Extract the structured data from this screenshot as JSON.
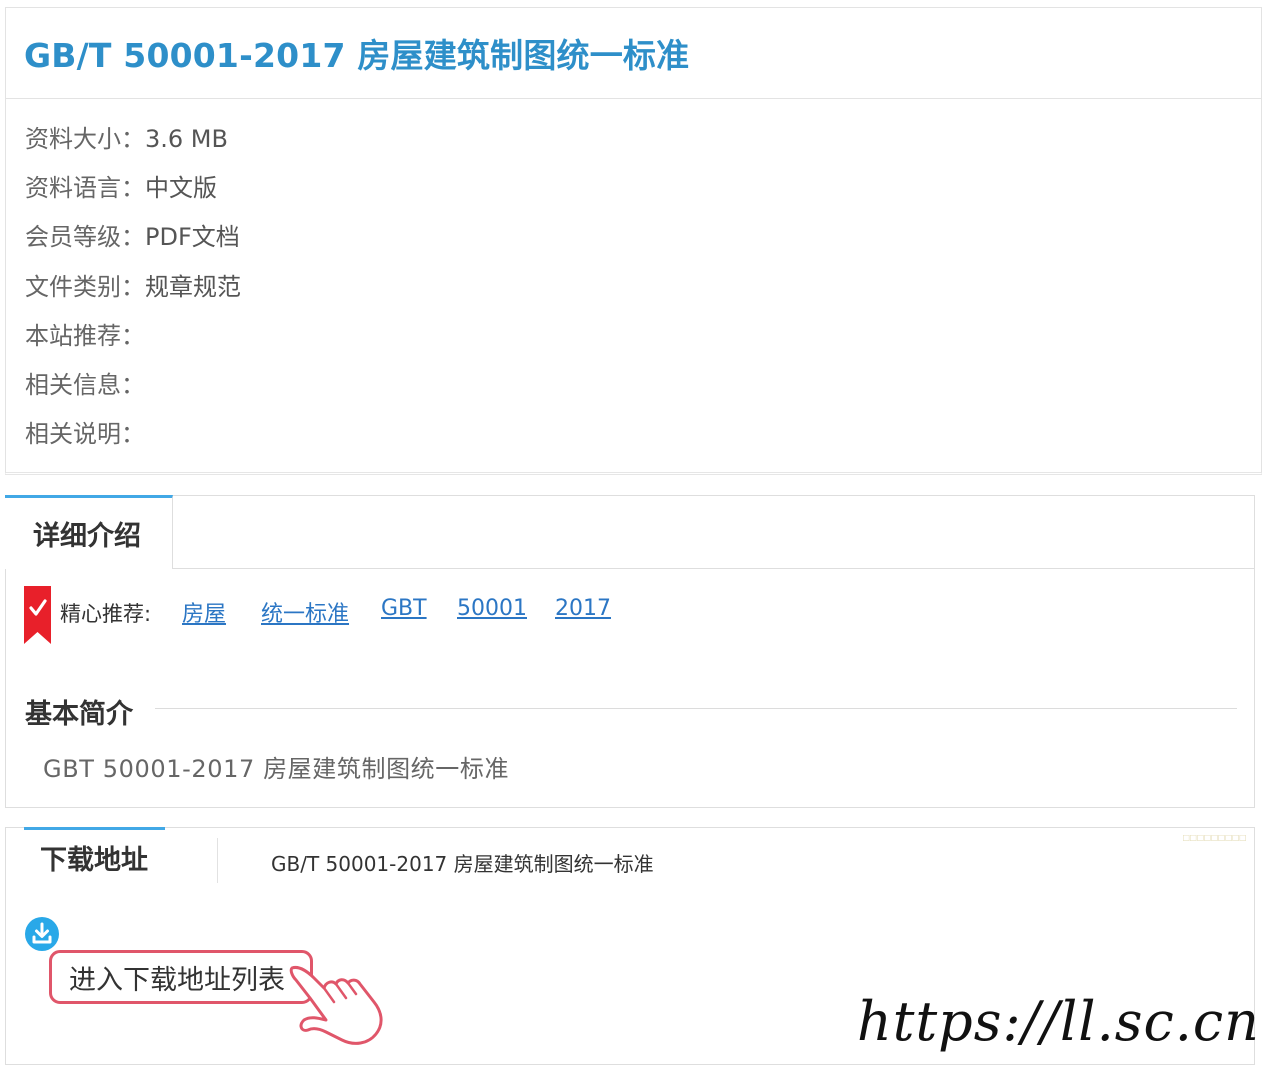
{
  "page": {
    "title": "GB/T 50001-2017 房屋建筑制图统一标准"
  },
  "info": {
    "rows": [
      {
        "label": "资料大小：",
        "value": "3.6 MB"
      },
      {
        "label": "资料语言：",
        "value": "中文版"
      },
      {
        "label": "会员等级：",
        "value": "PDF文档"
      },
      {
        "label": "文件类别：",
        "value": "规章规范"
      },
      {
        "label": "本站推荐：",
        "value": ""
      },
      {
        "label": "相关信息：",
        "value": ""
      },
      {
        "label": "相关说明：",
        "value": ""
      }
    ]
  },
  "detail": {
    "tab_label": "详细介绍",
    "recommend_label": "精心推荐:",
    "tags": [
      "房屋",
      "统一标准",
      "GBT",
      "50001",
      "2017"
    ],
    "intro_heading": "基本简介",
    "intro_text": "GBT 50001-2017 房屋建筑制图统一标准"
  },
  "download": {
    "tab_label": "下载地址",
    "file_title": "GB/T 50001-2017 房屋建筑制图统一标准",
    "button_label": "进入下载地址列表"
  },
  "watermark": "https://ll.sc.cn",
  "colors": {
    "title_blue": "#2e8fc9",
    "tab_accent": "#41a8e6",
    "link_blue": "#2b76c4",
    "button_border": "#e0566a",
    "bookmark_red": "#e8202a"
  },
  "icons": {
    "bookmark": "bookmark-check-icon",
    "download": "download-circle-icon",
    "pointer": "hand-pointer-icon"
  }
}
